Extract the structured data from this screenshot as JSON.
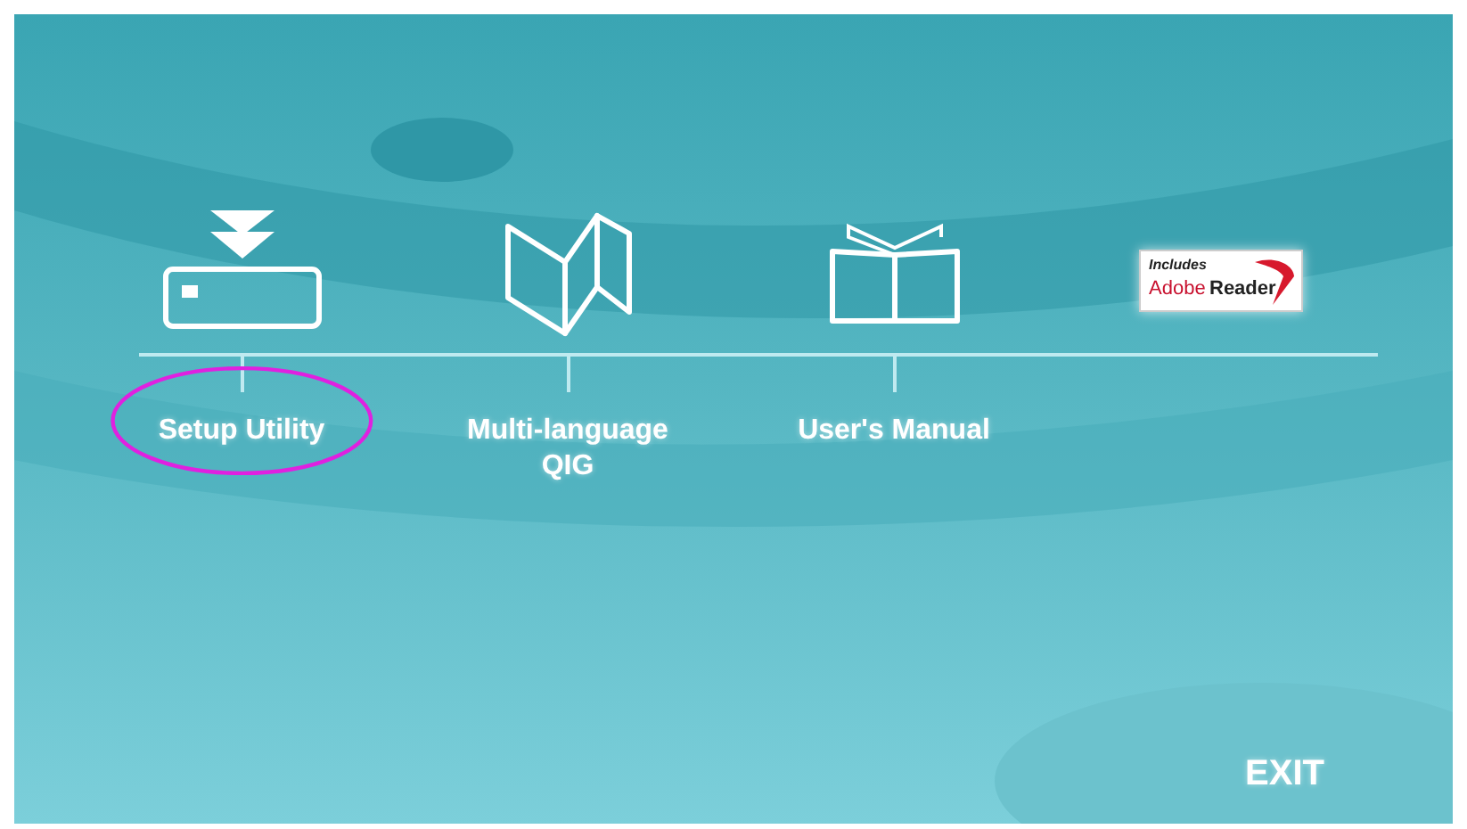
{
  "items": [
    {
      "kind": "installer",
      "label": "Setup Utility",
      "circled": true
    },
    {
      "kind": "map",
      "label": "Multi-language\nQIG",
      "circled": false
    },
    {
      "kind": "book",
      "label": "User's Manual",
      "circled": false
    },
    {
      "kind": "badge",
      "badge_top": "Includes",
      "badge_brand": "Adobe",
      "badge_product": "Reader"
    }
  ],
  "exit": "EXIT"
}
